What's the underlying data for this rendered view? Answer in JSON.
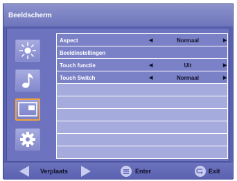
{
  "title": "Beeldscherm",
  "sidebar": {
    "items": [
      {
        "icon": "brightness-icon",
        "selected": false
      },
      {
        "icon": "music-note-icon",
        "selected": false
      },
      {
        "icon": "display-icon",
        "selected": true
      },
      {
        "icon": "gear-icon",
        "selected": false
      }
    ]
  },
  "menu": {
    "rows": [
      {
        "label": "Aspect",
        "value": "Normaal",
        "has_arrows": true,
        "active": true
      },
      {
        "label": "Beeldinstellingen",
        "value": "",
        "has_arrows": false,
        "active": true
      },
      {
        "label": "Touch functie",
        "value": "Uit",
        "has_arrows": true,
        "active": true
      },
      {
        "label": "Touch Switch",
        "value": "Normaal",
        "has_arrows": true,
        "active": true
      },
      {
        "label": "",
        "value": "",
        "has_arrows": false,
        "active": false
      },
      {
        "label": "",
        "value": "",
        "has_arrows": false,
        "active": false
      },
      {
        "label": "",
        "value": "",
        "has_arrows": false,
        "active": false
      },
      {
        "label": "",
        "value": "",
        "has_arrows": false,
        "active": false
      },
      {
        "label": "",
        "value": "",
        "has_arrows": false,
        "active": false
      },
      {
        "label": "",
        "value": "",
        "has_arrows": false,
        "active": false
      }
    ]
  },
  "footer": {
    "move_label": "Verplaats",
    "enter_label": "Enter",
    "exit_label": "Exit"
  },
  "colors": {
    "panel": "#5a61b0",
    "row_active": "#7b81c6",
    "row_empty": "#a6abdd",
    "selection_border": "#f2a23a"
  }
}
